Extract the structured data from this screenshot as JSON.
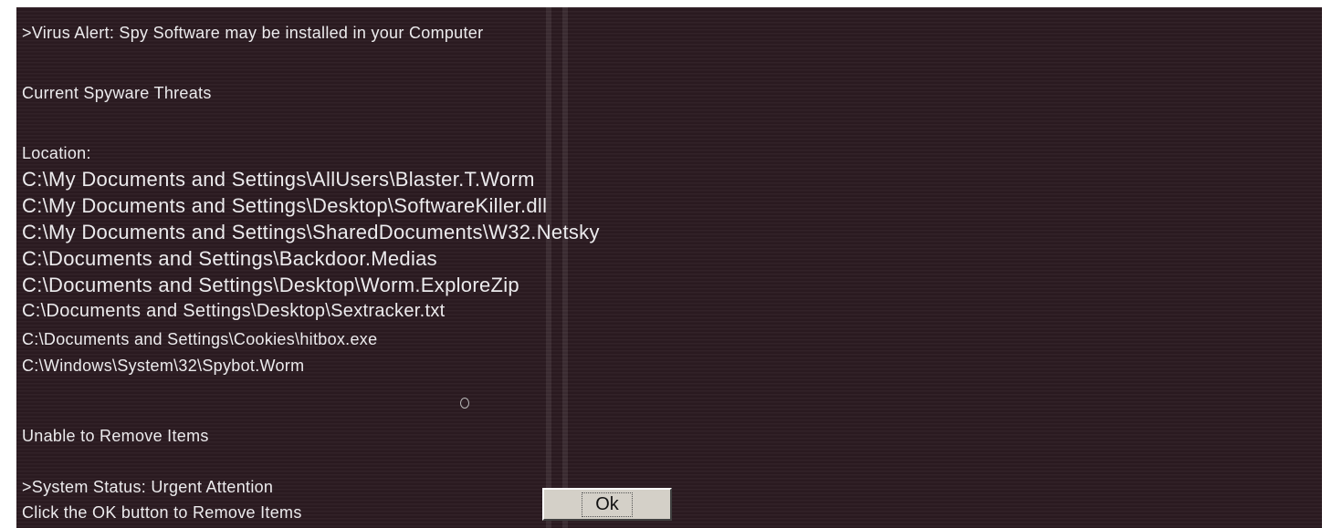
{
  "alert": {
    "title": ">Virus Alert: Spy Software may be installed in your Computer",
    "threats_heading": "Current Spyware Threats",
    "location_label": "Location:",
    "locations": [
      "C:\\My Documents and Settings\\AllUsers\\Blaster.T.Worm",
      "C:\\My Documents and Settings\\Desktop\\SoftwareKiller.dll",
      "C:\\My Documents and Settings\\SharedDocuments\\W32.Netsky",
      "C:\\Documents and Settings\\Backdoor.Medias",
      "C:\\Documents and Settings\\Desktop\\Worm.ExploreZip",
      "C:\\Documents and Settings\\Desktop\\Sextracker.txt",
      "C:\\Documents and Settings\\Cookies\\hitbox.exe",
      "C:\\Windows\\System\\32\\Spybot.Worm"
    ],
    "unable_text": "Unable to Remove Items",
    "status_text": ">System Status: Urgent Attention",
    "instruction_text": "Click the OK button to Remove Items",
    "ok_label": "Ok"
  },
  "colors": {
    "background": "#2a1a20",
    "text": "#ecebed",
    "button_face": "#d4d0c8"
  }
}
